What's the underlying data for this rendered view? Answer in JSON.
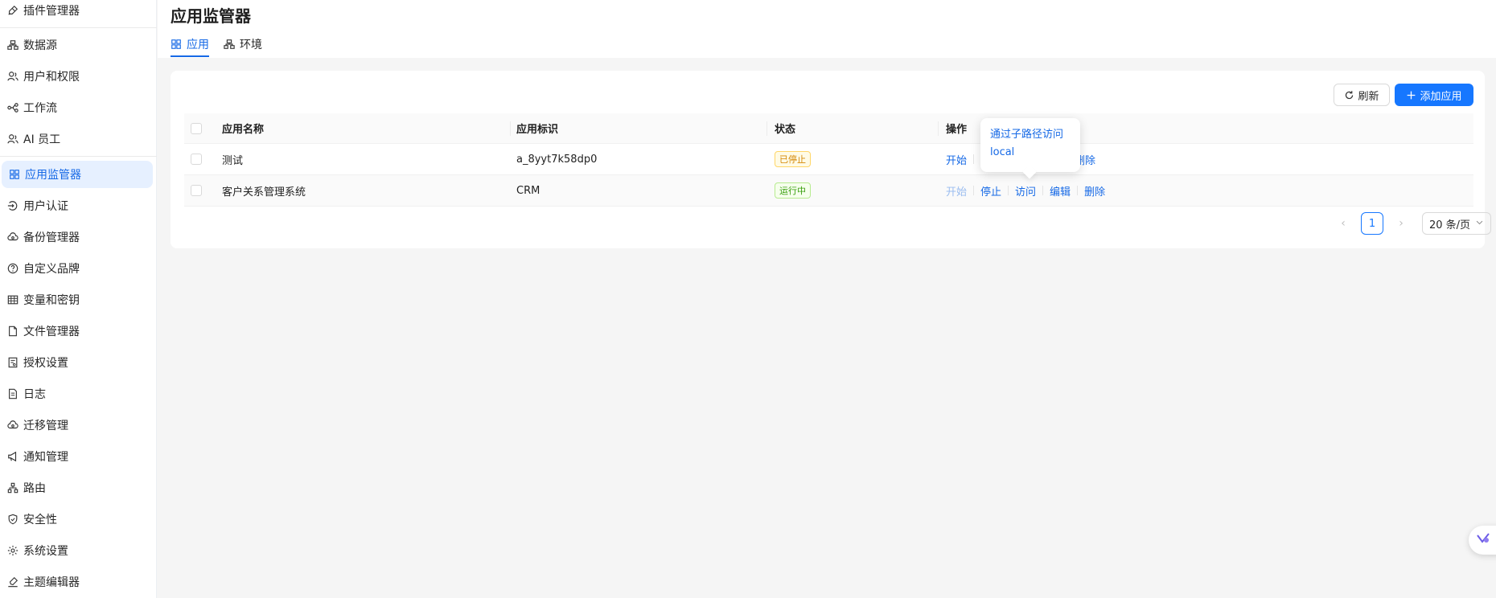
{
  "sidebar": {
    "items": [
      {
        "label": "插件管理器",
        "icon": "plug-icon"
      },
      {
        "label": "数据源",
        "icon": "database-icon"
      },
      {
        "label": "用户和权限",
        "icon": "users-icon"
      },
      {
        "label": "工作流",
        "icon": "workflow-icon"
      },
      {
        "label": "AI 员工",
        "icon": "ai-employee-icon"
      },
      {
        "label": "应用监管器",
        "icon": "apps-icon",
        "active": true
      },
      {
        "label": "用户认证",
        "icon": "login-icon"
      },
      {
        "label": "备份管理器",
        "icon": "cloud-backup-icon"
      },
      {
        "label": "自定义品牌",
        "icon": "help-circle-icon"
      },
      {
        "label": "变量和密钥",
        "icon": "table-icon"
      },
      {
        "label": "文件管理器",
        "icon": "file-icon"
      },
      {
        "label": "授权设置",
        "icon": "license-icon"
      },
      {
        "label": "日志",
        "icon": "log-icon"
      },
      {
        "label": "迁移管理",
        "icon": "cloud-migrate-icon"
      },
      {
        "label": "通知管理",
        "icon": "megaphone-icon"
      },
      {
        "label": "路由",
        "icon": "route-icon"
      },
      {
        "label": "安全性",
        "icon": "shield-icon"
      },
      {
        "label": "系统设置",
        "icon": "gear-icon"
      },
      {
        "label": "主题编辑器",
        "icon": "brush-icon"
      }
    ]
  },
  "header": {
    "title": "应用监管器",
    "tabs": [
      {
        "label": "应用",
        "icon": "apps-icon",
        "active": true
      },
      {
        "label": "环境",
        "icon": "environment-icon"
      }
    ]
  },
  "toolbar": {
    "refresh_label": "刷新",
    "add_label": "添加应用"
  },
  "table": {
    "columns": [
      "应用名称",
      "应用标识",
      "状态",
      "操作"
    ],
    "rows": [
      {
        "name": "测试",
        "id": "a_8yyt7k58dp0",
        "status": "已停止",
        "status_kind": "stopped",
        "actions": [
          "开始",
          "访问",
          "删除"
        ]
      },
      {
        "name": "客户关系管理系统",
        "id": "CRM",
        "status": "运行中",
        "status_kind": "running",
        "actions": [
          "开始",
          "停止",
          "访问",
          "编辑",
          "删除"
        ]
      }
    ]
  },
  "popover": {
    "items": [
      "通过子路径访问",
      "local"
    ]
  },
  "pagination": {
    "current_page": "1",
    "page_size": "20 条/页"
  },
  "colors": {
    "primary": "#1677ff",
    "active_bg": "#e6f0ff",
    "stopped": "#d48806",
    "running": "#389e0d"
  }
}
